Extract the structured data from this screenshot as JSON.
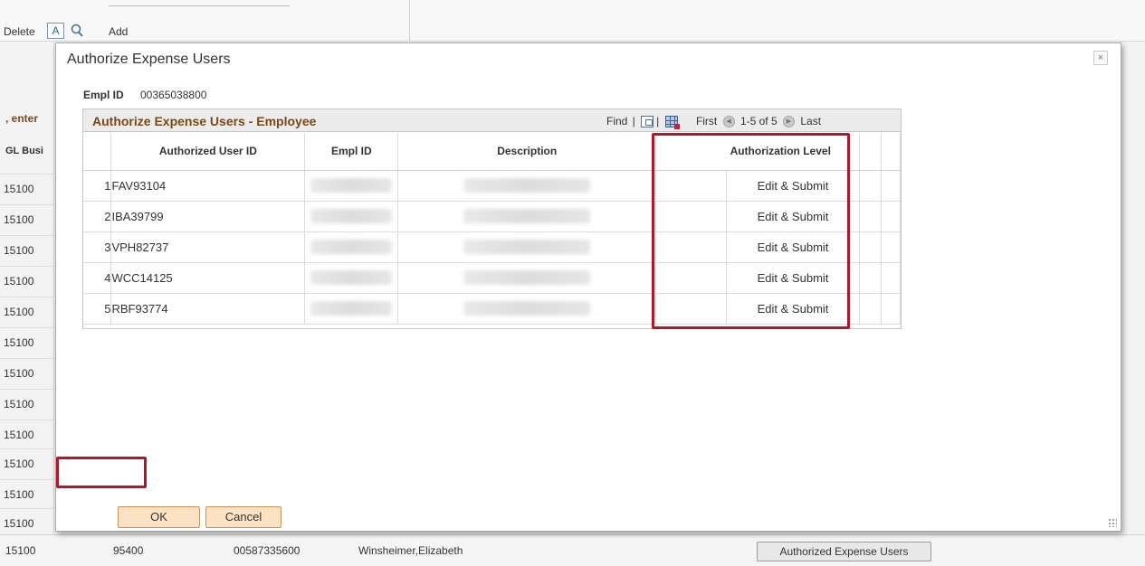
{
  "background": {
    "toolbar": {
      "delete_label": "Delete",
      "a_box": "A",
      "add_label": "Add"
    },
    "left_col": {
      "enter_label": ", enter",
      "gl_label": "GL Busi"
    },
    "rows": [
      "15100",
      "15100",
      "15100",
      "15100",
      "15100",
      "15100",
      "15100",
      "15100",
      "15100",
      "15100",
      "15100",
      "15100"
    ],
    "bottom_row": {
      "c1": "15100",
      "c2": "95400",
      "c3": "00587335600",
      "c4": "Winsheimer,Elizabeth",
      "button": "Authorized Expense Users"
    }
  },
  "modal": {
    "title": "Authorize Expense Users",
    "close_glyph": "×",
    "empl_id_label": "Empl ID",
    "empl_id_value": "00365038800",
    "grid": {
      "title": "Authorize Expense Users - Employee",
      "find_label": "Find",
      "first_label": "First",
      "range_label": "1-5 of 5",
      "last_label": "Last",
      "columns": [
        "Authorized User ID",
        "Empl ID",
        "Description",
        "Authorization Level"
      ],
      "rows": [
        {
          "num": "1",
          "user_id": "FAV93104",
          "level": "Edit & Submit"
        },
        {
          "num": "2",
          "user_id": "IBA39799",
          "level": "Edit & Submit"
        },
        {
          "num": "3",
          "user_id": "VPH82737",
          "level": "Edit & Submit"
        },
        {
          "num": "4",
          "user_id": "WCC14125",
          "level": "Edit & Submit"
        },
        {
          "num": "5",
          "user_id": "RBF93774",
          "level": "Edit & Submit"
        }
      ]
    },
    "buttons": {
      "ok": "OK",
      "cancel": "Cancel"
    }
  },
  "colors": {
    "highlight": "#b0172b",
    "grid_title": "#7b4718",
    "button_bg": "#fde2c3"
  }
}
